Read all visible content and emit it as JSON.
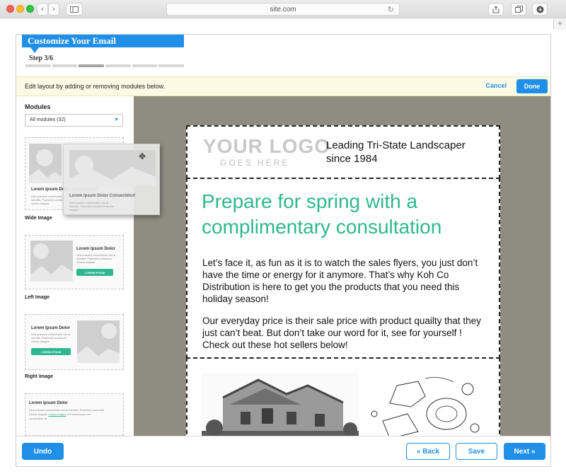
{
  "browser": {
    "url": "site.com",
    "back_icon": "chevron-left-icon",
    "forward_icon": "chevron-right-icon",
    "sidebar_icon": "sidebar-toggle-icon",
    "reload_icon": "reload-icon",
    "share_icon": "share-icon",
    "tabs_icon": "tabs-icon",
    "download_icon": "download-icon",
    "new_tab_icon": "plus-icon"
  },
  "header": {
    "title": "Customize Your Email",
    "step": "Step 3/6",
    "progress": {
      "total": 6,
      "current": 3
    }
  },
  "notice": {
    "text": "Edit layout by adding or removing modules below.",
    "cancel": "Cancel",
    "done": "Done"
  },
  "sidebar": {
    "title": "Modules",
    "filter": "All modules (32)",
    "modules": [
      {
        "caption": "Wide Image",
        "heading": "Lorem Ipsum Dolor Consectetur!",
        "text": "Sed posuere consectetur est at lobortis. Praesent commodo cursus magna."
      },
      {
        "caption": "Left Image",
        "heading": "Lorem Ipsum Dolor",
        "text": "Sed posuere consectetur est at lobortis. Praesent commodo cursus magna.",
        "button": "LOREM IPSUM"
      },
      {
        "caption": "Right Image",
        "heading": "Lorem Ipsum Dolor",
        "text": "Sed posuere consectetur est at lobortis. Praesent commodo cursus magna.",
        "button": "LOREM IPSUM"
      },
      {
        "caption": "",
        "heading": "Lorem Ipsum Dolor",
        "text1": "Sed posuere consectetur est at lobortis. Praesent commodo",
        "text2": "cursus magna,",
        "link": "cursus magna",
        "text3": "vel scelerisque nisl",
        "text4": "consectetur et."
      }
    ],
    "drag_ghost": {
      "heading": "Lorem Ipsum Dolor Consectetur!",
      "text": "Sed posuere consectetur est at lobortis. Praesent commodo cursus magna."
    }
  },
  "email": {
    "logo": "YOUR LOGO",
    "logo_sub": "GOES HERE",
    "tagline": "Leading Tri-State Landscaper since 1984",
    "headline": "Prepare for spring with a complimentary consultation",
    "para1": "Let’s face it, as fun as it is to watch the sales flyers, you just don’t have the time or energy for it anymore. That’s why Koh Co Distribution is here to get you the products that you need this holiday season!",
    "para2": "Our everyday price is their sale price with product quailty that they just can’t beat. But don’t take our word for it, see for yourself ! Check out these hot sellers below!"
  },
  "footer": {
    "undo": "Undo",
    "back": "« Back",
    "save": "Save",
    "next": "Next »"
  },
  "colors": {
    "accent": "#1f8fe8",
    "headline_green": "#2fb88d",
    "canvas_bg": "#8f8c80",
    "notice_bg": "#fcfae4"
  }
}
